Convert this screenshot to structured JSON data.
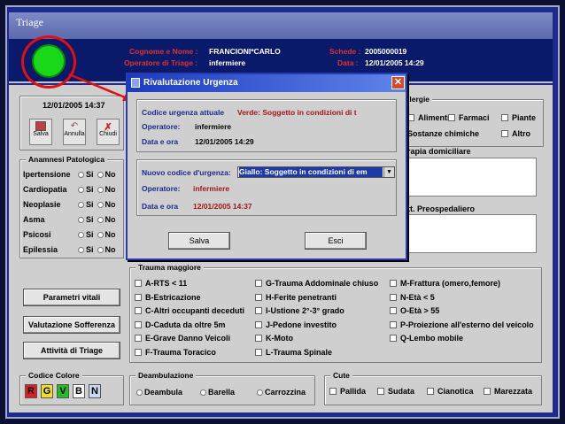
{
  "window": {
    "title": "Triage"
  },
  "header": {
    "surname_label": "Cognome e Nome :",
    "surname_value": "FRANCIONI*CARLO",
    "operator_label": "Operatore di Triage :",
    "operator_value": "infermiere",
    "schede_label": "Schede :",
    "schede_value": "2005000019",
    "data_label": "Data :",
    "data_value": "12/01/2005 14:29"
  },
  "toolbar": {
    "datetime": "12/01/2005 14:37",
    "save_label": "Salva",
    "cancel_label": "Annulla",
    "close_label": "Chiudi"
  },
  "anamnesi": {
    "legend": "Anamnesi Patologica",
    "yes": "Si",
    "no": "No",
    "items": [
      "Ipertensione",
      "Cardiopatia",
      "Neoplasie",
      "Asma",
      "Psicosi",
      "Epilessia"
    ]
  },
  "allergie": {
    "legend": "llergie",
    "items": [
      "Alimenti",
      "Farmaci",
      "Piante",
      "Sostanze chimiche",
      "Altro"
    ]
  },
  "terapia": {
    "legend": "rapia domiciliare"
  },
  "preosp": {
    "legend": "tt. Preospedaliero"
  },
  "side_buttons": [
    "Parametri vitali",
    "Valutazione Sofferenza",
    "Attività di Triage"
  ],
  "trauma": {
    "legend": "Trauma maggiore",
    "col1": [
      "A-RTS < 11",
      "B-Estricazione",
      "C-Altri occupanti deceduti",
      "D-Caduta da oltre 5m",
      "E-Grave Danno Veicoli",
      "F-Trauma Toracico"
    ],
    "col2": [
      "G-Trauma Addominale chiuso",
      "H-Ferite penetranti",
      "I-Ustione 2°-3° grado",
      "J-Pedone investito",
      "K-Moto",
      "L-Trauma Spinale"
    ],
    "col3": [
      "M-Frattura (omero,femore)",
      "N-Età < 5",
      "O-Età > 55",
      "P-Proiezione all'esterno del veicolo",
      "Q-Lembo mobile"
    ]
  },
  "codice_colore": {
    "legend": "Codice Colore",
    "codes": [
      {
        "l": "R",
        "c": "#e02020"
      },
      {
        "l": "G",
        "c": "#f0e020"
      },
      {
        "l": "V",
        "c": "#20c020"
      },
      {
        "l": "B",
        "c": "#ffffff"
      },
      {
        "l": "N",
        "c": "#c8d8f0"
      }
    ]
  },
  "deambulazione": {
    "legend": "Deambulazione",
    "items": [
      "Deambula",
      "Barella",
      "Carrozzina"
    ]
  },
  "cute": {
    "legend": "Cute",
    "items": [
      "Pallida",
      "Sudata",
      "Cianotica",
      "Marezzata"
    ]
  },
  "dialog": {
    "title": "Rivalutazione Urgenza",
    "current_label": "Codice urgenza attuale",
    "current_value": "Verde: Soggetto in condizioni di t",
    "op_label": "Operatore:",
    "op_value": "infermiere",
    "date_label": "Data e ora",
    "date_value": "12/01/2005 14:29",
    "new_label": "Nuovo codice d'urgenza:",
    "new_value": "Giallo: Soggetto in condizioni di em",
    "op2_label": "Operatore:",
    "op2_value": "infermiere",
    "date2_label": "Data e ora",
    "date2_value": "12/01/2005 14:37",
    "save_label": "Salva",
    "exit_label": "Esci"
  },
  "colors": {
    "accent": "#1c3ac0",
    "highlight_ring": "#e01010",
    "status_green": "#18d818"
  }
}
